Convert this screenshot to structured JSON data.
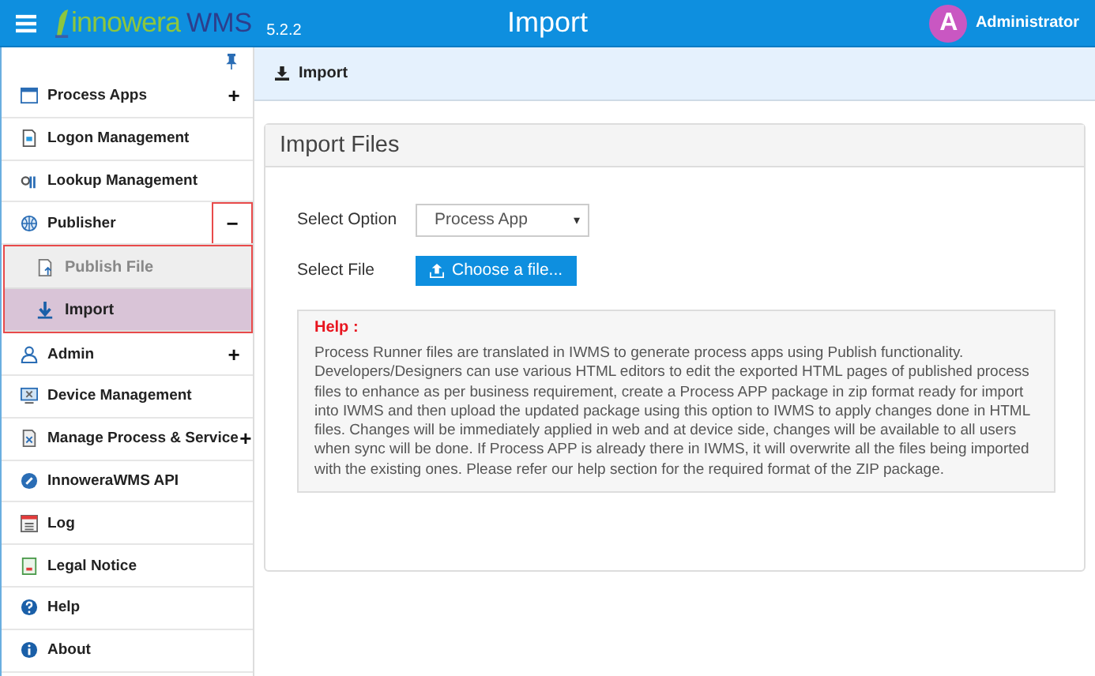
{
  "header": {
    "logo_brand": "innowera",
    "logo_product": "WMS",
    "version": "5.2.2",
    "title": "Import",
    "avatar": "A",
    "user": "Administrator"
  },
  "sidebar": {
    "items": [
      {
        "label": "Process Apps",
        "toggle": "+"
      },
      {
        "label": "Logon Management"
      },
      {
        "label": "Lookup Management"
      },
      {
        "label": "Publisher",
        "toggle": "−",
        "highlighted": true,
        "children": [
          {
            "label": "Publish File",
            "selected": false
          },
          {
            "label": "Import",
            "selected": true
          }
        ]
      },
      {
        "label": "Admin",
        "toggle": "+"
      },
      {
        "label": "Device Management"
      },
      {
        "label": "Manage Process & Service",
        "toggle": "+"
      },
      {
        "label": "InnoweraWMS API"
      },
      {
        "label": "Log"
      },
      {
        "label": "Legal Notice"
      },
      {
        "label": "Help"
      },
      {
        "label": "About"
      }
    ]
  },
  "breadcrumb": "Import",
  "panel": {
    "title": "Import Files",
    "option_label": "Select Option",
    "option_value": "Process App",
    "option_caret": "▾",
    "file_label": "Select File",
    "file_button": "Choose a file...",
    "help_title": "Help :",
    "help_text": "Process Runner files are translated in IWMS to generate process apps using Publish functionality. Developers/Designers can use various HTML editors to edit the exported HTML pages of published process files to enhance as per business requirement, create a Process APP package in zip format ready for import into IWMS and then upload the updated package using this option to IWMS to apply changes done in HTML files. Changes will be immediately applied in web and at device side, changes will be available to all users when sync will be done. If Process APP is already there in IWMS, it will overwrite all the files being imported with the existing ones. Please refer our help section for the required format of the ZIP package."
  }
}
